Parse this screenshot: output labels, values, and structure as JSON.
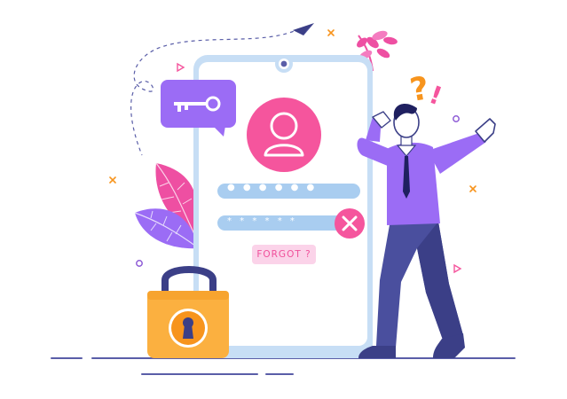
{
  "login": {
    "username_mask": "● ● ● ● ● ●",
    "password_mask": "* * * * * *",
    "forgot_label": "FORGOT ?"
  },
  "colors": {
    "phone_frame": "#c7def5",
    "phone_screen": "#ffffff",
    "field": "#a9cdf0",
    "accent_pink": "#f5559d",
    "accent_purple": "#9b6cf5",
    "lock_body": "#fbb040",
    "warning_orange": "#f7941d"
  },
  "icons": [
    "key-icon",
    "user-avatar-icon",
    "clear-x-icon",
    "padlock-icon",
    "paper-plane-icon",
    "question-mark-icon",
    "exclamation-icon"
  ]
}
